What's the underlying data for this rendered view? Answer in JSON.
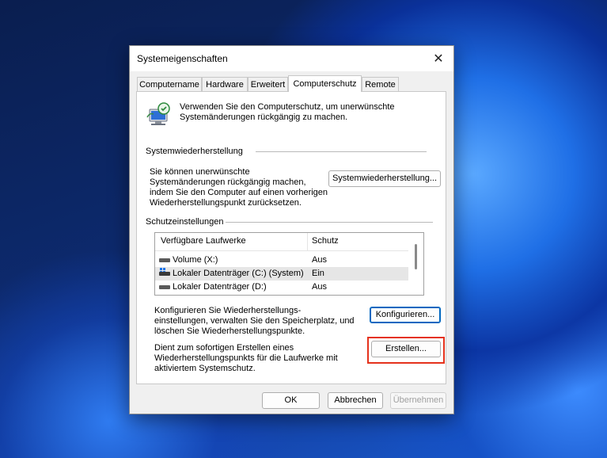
{
  "window": {
    "title": "Systemeigenschaften"
  },
  "tabs": [
    {
      "label": "Computername"
    },
    {
      "label": "Hardware"
    },
    {
      "label": "Erweitert"
    },
    {
      "label": "Computerschutz"
    },
    {
      "label": "Remote"
    }
  ],
  "intro": {
    "text_line1": "Verwenden Sie den Computerschutz, um unerwünschte",
    "text_line2": "Systemänderungen rückgängig zu machen."
  },
  "restore": {
    "heading": "Systemwiederherstellung",
    "desc_line1": "Sie können unerwünschte",
    "desc_line2": "Systemänderungen rückgängig machen,",
    "desc_line3": "indem Sie den Computer auf einen vorherigen",
    "desc_line4": "Wiederherstellungspunkt zurücksetzen.",
    "button": "Systemwiederherstellung..."
  },
  "protection": {
    "heading": "Schutzeinstellungen",
    "columns": {
      "drives": "Verfügbare Laufwerke",
      "protection": "Schutz"
    },
    "rows": [
      {
        "drive": "Volume (X:)",
        "status": "Aus"
      },
      {
        "drive": "Lokaler Datenträger (C:) (System)",
        "status": "Ein"
      },
      {
        "drive": "Lokaler Datenträger (D:)",
        "status": "Aus"
      }
    ],
    "configure_line1": "Konfigurieren Sie Wiederherstellungs-",
    "configure_line2": "einstellungen, verwalten Sie den Speicherplatz, und",
    "configure_line3": "löschen Sie Wiederherstellungspunkte.",
    "configure_button": "Konfigurieren...",
    "create_line1": "Dient zum sofortigen Erstellen eines",
    "create_line2": "Wiederherstellungspunkts für die Laufwerke mit",
    "create_line3": "aktiviertem Systemschutz.",
    "create_button": "Erstellen..."
  },
  "footer": {
    "ok": "OK",
    "cancel": "Abbrechen",
    "apply": "Übernehmen"
  },
  "colors": {
    "highlight": "#e5321c",
    "focus": "#0067c0"
  }
}
